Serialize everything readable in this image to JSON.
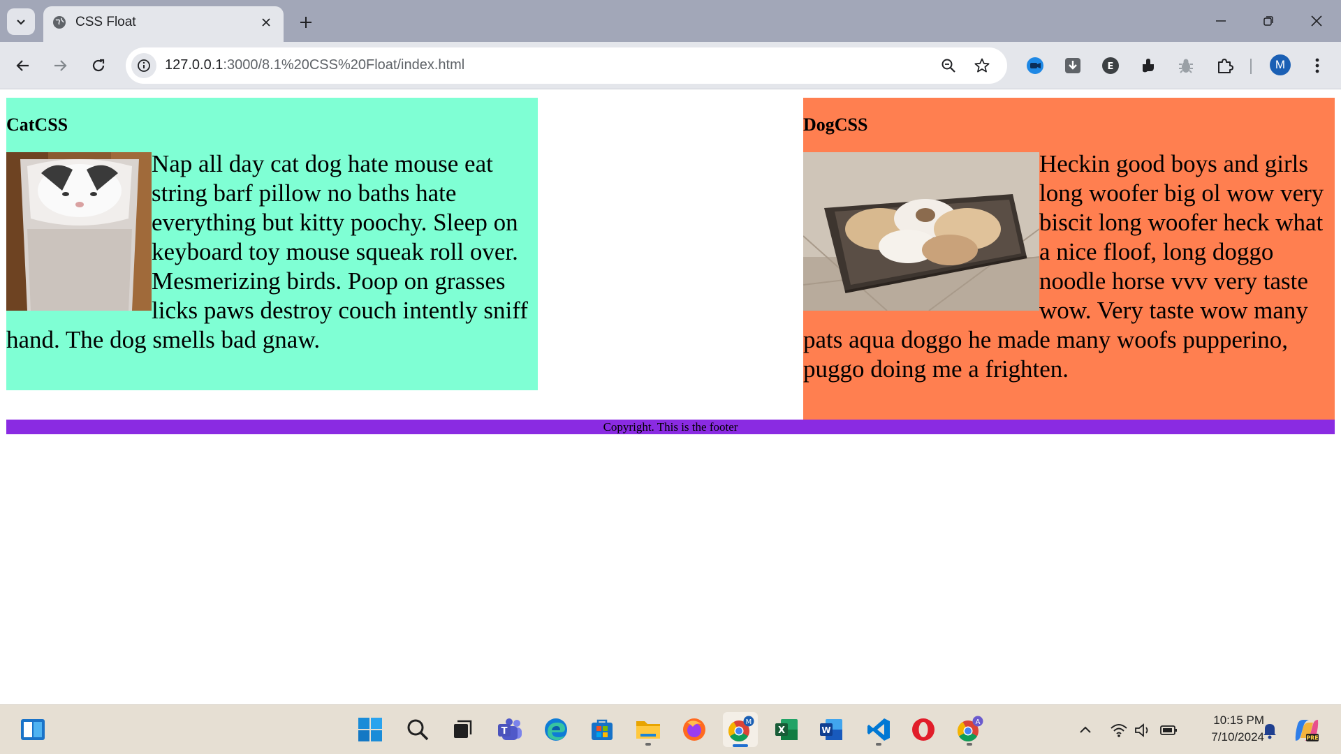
{
  "browser": {
    "tab_title": "CSS Float",
    "url_host": "127.0.0.1",
    "url_rest": ":3000/8.1%20CSS%20Float/index.html",
    "avatar_letter": "M"
  },
  "page": {
    "cat": {
      "title": "CatCSS",
      "text": "Nap all day cat dog hate mouse eat string barf pillow no baths hate everything but kitty poochy. Sleep on keyboard toy mouse squeak roll over. Mesmerizing birds. Poop on grasses licks paws destroy couch intently sniff hand. The dog smells bad gnaw.",
      "bg_color": "#7fffd4"
    },
    "dog": {
      "title": "DogCSS",
      "text": "Heckin good boys and girls long woofer big ol wow very biscit long woofer heck what a nice floof, long doggo noodle horse vvv very taste wow. Very taste wow many pats aqua doggo he made many woofs pupperino, puggo doing me a frighten.",
      "bg_color": "#ff7f50"
    },
    "footer": {
      "text": "Copyright. This is the footer",
      "bg_color": "#8a2be2"
    }
  },
  "taskbar": {
    "time": "10:15 PM",
    "date": "7/10/2024",
    "pinned": [
      "start-icon",
      "search-icon",
      "task-view-icon",
      "teams-icon",
      "edge-icon",
      "store-icon",
      "file-explorer-icon",
      "firefox-icon",
      "chrome-icon",
      "excel-icon",
      "word-icon",
      "vscode-icon",
      "opera-icon",
      "chrome-profile-icon"
    ]
  }
}
